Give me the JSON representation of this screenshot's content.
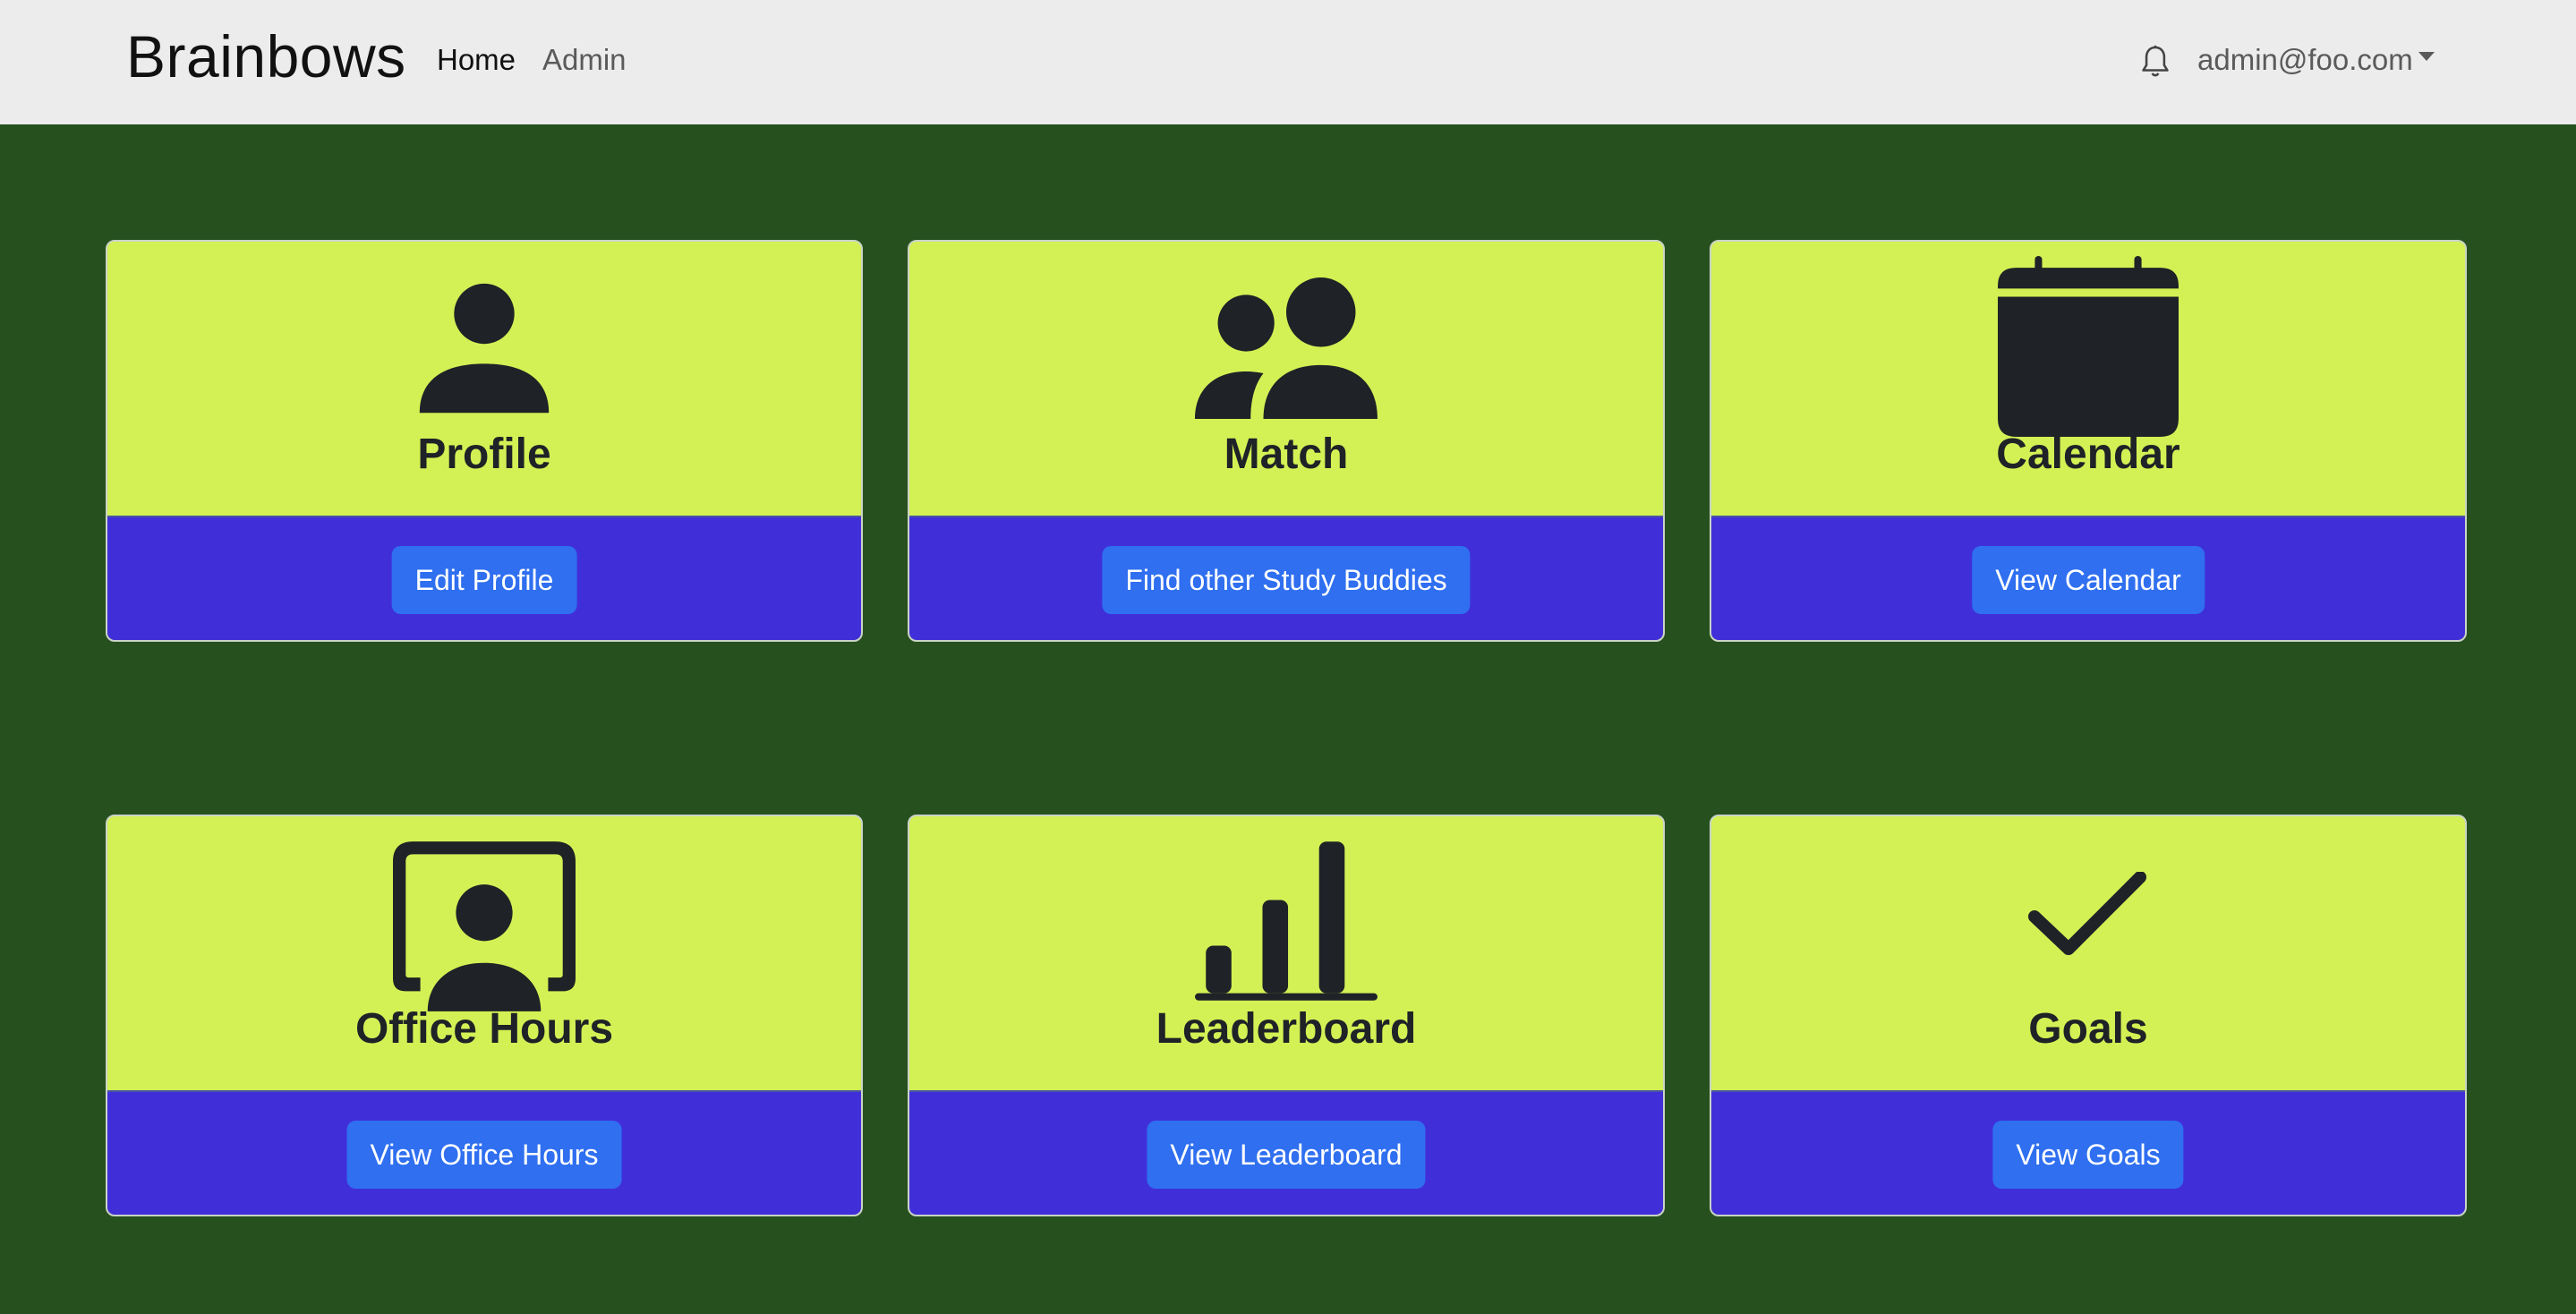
{
  "navbar": {
    "brand": "Brainbows",
    "links": [
      {
        "label": "Home"
      },
      {
        "label": "Admin"
      }
    ],
    "user_email": "admin@foo.com",
    "bell_icon": "bell-icon"
  },
  "cards": [
    {
      "title": "Profile",
      "button": "Edit Profile",
      "icon": "person-icon"
    },
    {
      "title": "Match",
      "button": "Find other Study Buddies",
      "icon": "people-icon"
    },
    {
      "title": "Calendar",
      "button": "View Calendar",
      "icon": "calendar-icon"
    },
    {
      "title": "Office Hours",
      "button": "View Office Hours",
      "icon": "person-video-icon"
    },
    {
      "title": "Leaderboard",
      "button": "View Leaderboard",
      "icon": "bar-chart-icon"
    },
    {
      "title": "Goals",
      "button": "View Goals",
      "icon": "check-icon"
    }
  ],
  "colors": {
    "page_background": "#27501f",
    "navbar_background": "#ececec",
    "card_top": "#d3f155",
    "card_bottom": "#402fd9",
    "button": "#2f6ff0",
    "icon": "#1f2226"
  }
}
